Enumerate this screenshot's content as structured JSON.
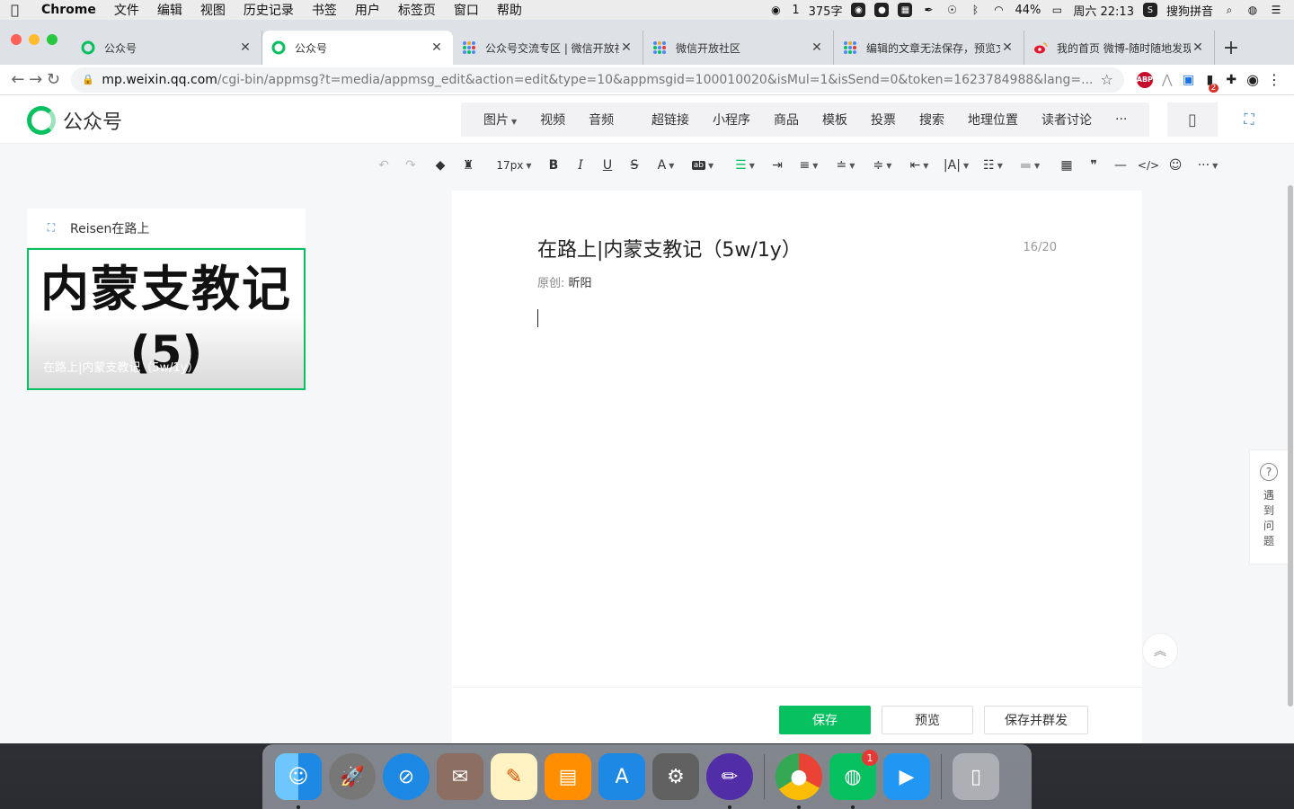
{
  "menubar": {
    "app_name": "Chrome",
    "items": [
      "文件",
      "编辑",
      "视图",
      "历史记录",
      "书签",
      "用户",
      "标签页",
      "窗口",
      "帮助"
    ],
    "status": {
      "wechat_count": "1",
      "char_count": "375字",
      "battery": "44%",
      "datetime": "周六 22:13",
      "input_method": "搜狗拼音"
    }
  },
  "browser": {
    "tabs": [
      {
        "label": "公众号",
        "icon": "wechat-mp-icon"
      },
      {
        "label": "公众号",
        "icon": "wechat-mp-icon",
        "active": true
      },
      {
        "label": "公众号交流专区 | 微信开放社区",
        "icon": "wechat-dev-icon"
      },
      {
        "label": "微信开放社区",
        "icon": "wechat-dev-icon"
      },
      {
        "label": "编辑的文章无法保存，预览文章",
        "icon": "wechat-dev-icon"
      },
      {
        "label": "我的首页 微博-随时随地发现新鲜事",
        "icon": "weibo-icon"
      }
    ],
    "url_host": "mp.weixin.qq.com",
    "url_path": "/cgi-bin/appmsg?t=media/appmsg_edit&action=edit&type=10&appmsgid=100010020&isMul=1&isSend=0&token=1623784988&lang=...",
    "extensions": {
      "abp": "ABP",
      "badge": "2"
    }
  },
  "header": {
    "logo_text": "公众号",
    "media_buttons": [
      "图片",
      "视频",
      "音频"
    ],
    "insert_buttons": [
      "超链接",
      "小程序",
      "商品",
      "模板",
      "投票",
      "搜索",
      "地理位置",
      "读者讨论"
    ],
    "more": "···"
  },
  "format_toolbar": {
    "font_size": "17px"
  },
  "article_card": {
    "account_name": "Reisen在路上",
    "cover_line1": "内蒙支教记",
    "cover_line2": "(5)",
    "cover_caption": "在路上|内蒙支教记（5w/1y）"
  },
  "editor": {
    "title": "在路上|内蒙支教记（5w/1y）",
    "title_count": "16/20",
    "author_label": "原创:",
    "author_name": "昕阳",
    "save": "保存",
    "preview": "预览",
    "save_send": "保存并群发"
  },
  "help": {
    "icon_text": "?",
    "chars": [
      "遇",
      "到",
      "问",
      "题"
    ]
  },
  "dock": {
    "wechat_badge": "1"
  },
  "colors": {
    "accent": "#07c160",
    "tab_bg": "#dee1e6"
  }
}
